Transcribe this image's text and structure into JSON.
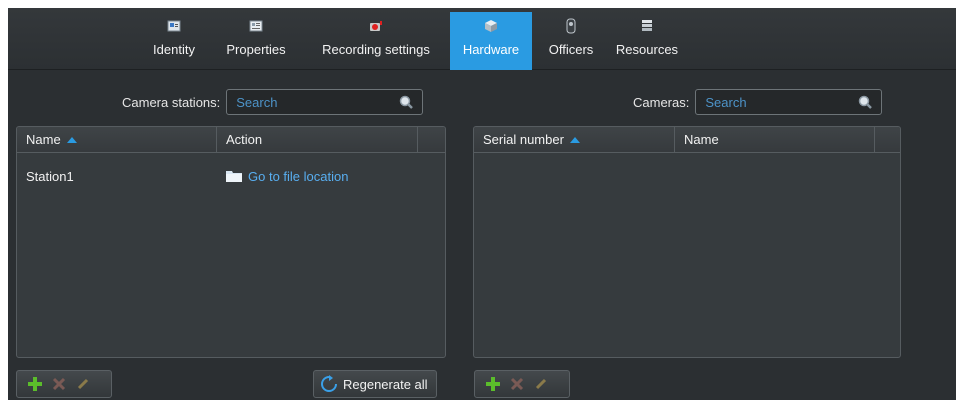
{
  "tabs": [
    {
      "label": "Identity",
      "icon": "identity-card-icon"
    },
    {
      "label": "Properties",
      "icon": "properties-icon"
    },
    {
      "label": "Recording settings",
      "icon": "recording-icon"
    },
    {
      "label": "Hardware",
      "icon": "hardware-box-icon",
      "active": true
    },
    {
      "label": "Officers",
      "icon": "officer-icon"
    },
    {
      "label": "Resources",
      "icon": "resources-server-icon"
    }
  ],
  "left": {
    "search_label": "Camera stations:",
    "search_placeholder": "Search",
    "columns": [
      "Name",
      "Action"
    ],
    "rows": [
      {
        "name": "Station1",
        "action": "Go to file location"
      }
    ],
    "regenerate_label": "Regenerate all"
  },
  "right": {
    "search_label": "Cameras:",
    "search_placeholder": "Search",
    "columns": [
      "Serial number",
      "Name"
    ],
    "rows": []
  },
  "colors": {
    "accent": "#2a9be2",
    "link": "#58aef0",
    "background": "#2b2f32",
    "add_green": "#5bbd2b"
  }
}
